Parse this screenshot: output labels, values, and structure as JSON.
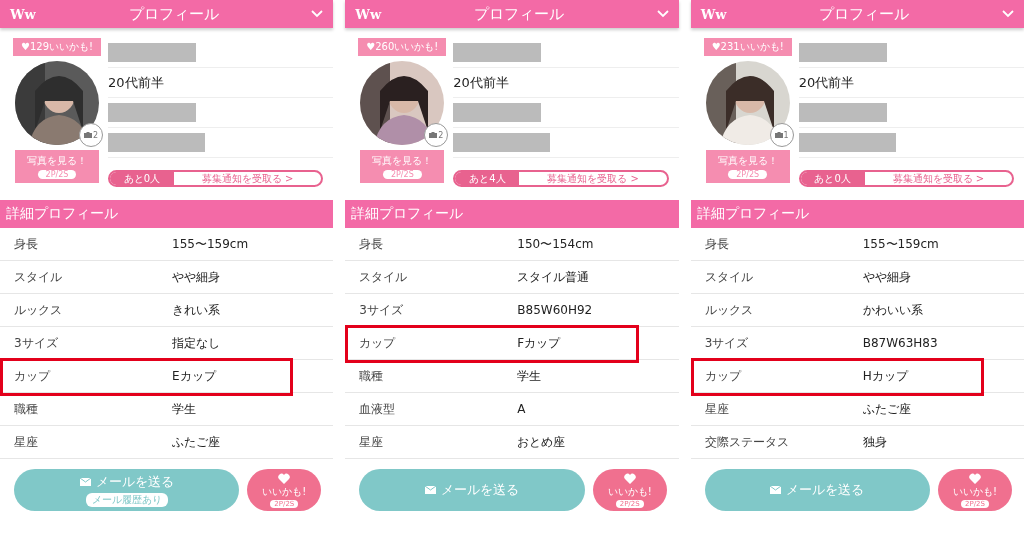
{
  "panels": [
    {
      "header": {
        "logo": "Ww",
        "title": "プロフィール"
      },
      "likes": "♥129いいかも!",
      "age": "20代前半",
      "photo_count": "2",
      "photo_button": {
        "label": "写真を見る！",
        "price": "2P/2S"
      },
      "recruit": {
        "remaining": "あと0人",
        "action": "募集通知を受取る >"
      },
      "section_title": "詳細プロフィール",
      "rows": [
        {
          "label": "身長",
          "value": "155〜159cm",
          "highlighted": false
        },
        {
          "label": "スタイル",
          "value": "やや細身",
          "highlighted": false
        },
        {
          "label": "ルックス",
          "value": "きれい系",
          "highlighted": false
        },
        {
          "label": "3サイズ",
          "value": "指定なし",
          "highlighted": false
        },
        {
          "label": "カップ",
          "value": "Eカップ",
          "highlighted": true
        },
        {
          "label": "職種",
          "value": "学生",
          "highlighted": false
        },
        {
          "label": "星座",
          "value": "ふたご座",
          "highlighted": false
        }
      ],
      "mail_button": {
        "label": "メールを送る",
        "note": "メール履歴あり"
      },
      "like_button": {
        "label": "いいかも!",
        "price": "2P/2S"
      }
    },
    {
      "header": {
        "logo": "Ww",
        "title": "プロフィール"
      },
      "likes": "♥260いいかも!",
      "age": "20代前半",
      "photo_count": "2",
      "photo_button": {
        "label": "写真を見る！",
        "price": "2P/2S"
      },
      "recruit": {
        "remaining": "あと4人",
        "action": "募集通知を受取る >"
      },
      "section_title": "詳細プロフィール",
      "rows": [
        {
          "label": "身長",
          "value": "150〜154cm",
          "highlighted": false
        },
        {
          "label": "スタイル",
          "value": "スタイル普通",
          "highlighted": false
        },
        {
          "label": "3サイズ",
          "value": "B85W60H92",
          "highlighted": false
        },
        {
          "label": "カップ",
          "value": "Fカップ",
          "highlighted": true
        },
        {
          "label": "職種",
          "value": "学生",
          "highlighted": false
        },
        {
          "label": "血液型",
          "value": "A",
          "highlighted": false
        },
        {
          "label": "星座",
          "value": "おとめ座",
          "highlighted": false
        }
      ],
      "mail_button": {
        "label": "メールを送る"
      },
      "like_button": {
        "label": "いいかも!",
        "price": "2P/2S"
      }
    },
    {
      "header": {
        "logo": "Ww",
        "title": "プロフィール"
      },
      "likes": "♥231いいかも!",
      "age": "20代前半",
      "photo_count": "1",
      "photo_button": {
        "label": "写真を見る！",
        "price": "2P/2S"
      },
      "recruit": {
        "remaining": "あと0人",
        "action": "募集通知を受取る >"
      },
      "section_title": "詳細プロフィール",
      "rows": [
        {
          "label": "身長",
          "value": "155〜159cm",
          "highlighted": false
        },
        {
          "label": "スタイル",
          "value": "やや細身",
          "highlighted": false
        },
        {
          "label": "ルックス",
          "value": "かわいい系",
          "highlighted": false
        },
        {
          "label": "3サイズ",
          "value": "B87W63H83",
          "highlighted": false
        },
        {
          "label": "カップ",
          "value": "Hカップ",
          "highlighted": true
        },
        {
          "label": "星座",
          "value": "ふたご座",
          "highlighted": false
        },
        {
          "label": "交際ステータス",
          "value": "独身",
          "highlighted": false
        }
      ],
      "mail_button": {
        "label": "メールを送る"
      },
      "like_button": {
        "label": "いいかも!",
        "price": "2P/2S"
      }
    }
  ]
}
